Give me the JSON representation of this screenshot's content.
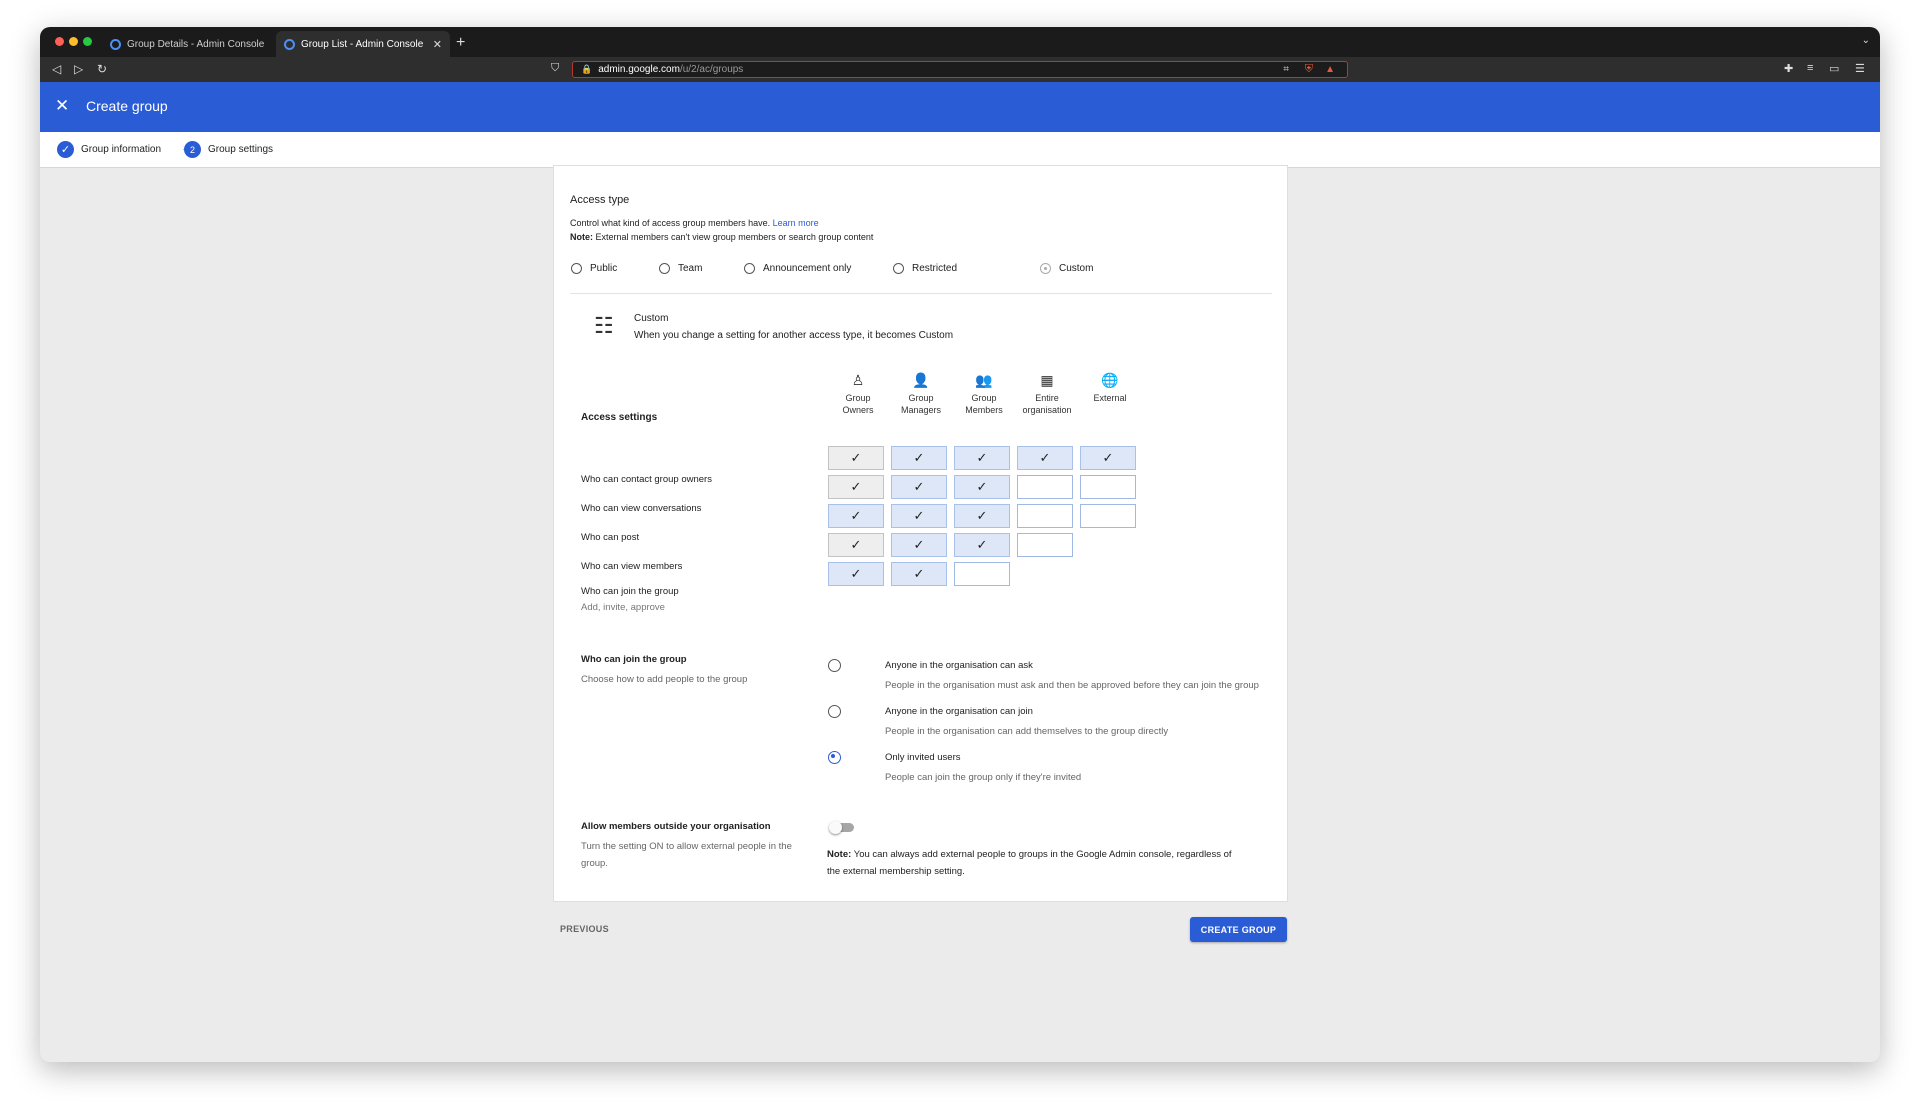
{
  "browser": {
    "tabs": [
      {
        "title": "Group Details - Admin Console",
        "active": false
      },
      {
        "title": "Group List - Admin Console",
        "active": true
      }
    ],
    "url_host": "admin.google.com",
    "url_path": "/u/2/ac/groups"
  },
  "appbar": {
    "title": "Create group"
  },
  "stepper": {
    "steps": [
      {
        "label": "Group information",
        "state": "done"
      },
      {
        "number": "2",
        "label": "Group settings",
        "state": "current"
      }
    ]
  },
  "access_type": {
    "heading": "Access type",
    "description": "Control what kind of access group members have.",
    "learn_more": "Learn more",
    "note_label": "Note:",
    "note_text": "External members can't view group members or search group content",
    "options": [
      "Public",
      "Team",
      "Announcement only",
      "Restricted",
      "Custom"
    ],
    "selected": "Custom"
  },
  "custom_info": {
    "title": "Custom",
    "description": "When you change a setting for another access type, it becomes Custom"
  },
  "access_settings": {
    "heading": "Access settings",
    "columns": [
      {
        "label_1": "Group",
        "label_2": "Owners",
        "icon": "person-outline-icon"
      },
      {
        "label_1": "Group",
        "label_2": "Managers",
        "icon": "person-icon"
      },
      {
        "label_1": "Group",
        "label_2": "Members",
        "icon": "people-icon"
      },
      {
        "label_1": "Entire",
        "label_2": "organisation",
        "icon": "building-icon"
      },
      {
        "label_1": "External",
        "label_2": "",
        "icon": "globe-icon"
      }
    ],
    "rows": [
      {
        "label": "Who can contact group owners",
        "sub": "",
        "cells": [
          "grey-check",
          "blue-check",
          "blue-check",
          "blue-check",
          "blue-check"
        ]
      },
      {
        "label": "Who can view conversations",
        "sub": "",
        "cells": [
          "grey-check",
          "blue-check",
          "blue-check",
          "empty",
          "empty"
        ]
      },
      {
        "label": "Who can post",
        "sub": "",
        "cells": [
          "blue-check",
          "blue-check",
          "blue-check",
          "empty",
          "empty"
        ]
      },
      {
        "label": "Who can view members",
        "sub": "",
        "cells": [
          "grey-check",
          "blue-check",
          "blue-check",
          "empty",
          "none"
        ]
      },
      {
        "label": "Who can join the group",
        "sub": "Add, invite, approve",
        "cells": [
          "blue-check",
          "blue-check",
          "empty",
          "none",
          "none"
        ]
      }
    ],
    "check_glyph": "✓"
  },
  "join": {
    "heading": "Who can join the group",
    "description": "Choose how to add people to the group",
    "options": [
      {
        "label": "Anyone in the organisation can ask",
        "desc": "People in the organisation must ask and then be approved before they can join the group"
      },
      {
        "label": "Anyone in the organisation can join",
        "desc": "People in the organisation can add themselves to the group directly"
      },
      {
        "label": "Only invited users",
        "desc": "People can join the group only if they're invited"
      }
    ],
    "selected": "Only invited users"
  },
  "external": {
    "heading": "Allow members outside your organisation",
    "description_1": "Turn the setting ON to allow external people in the",
    "description_2": "group.",
    "toggle_on": false,
    "note_label": "Note:",
    "note_text_1": "You can always add external people to groups in the Google Admin console, regardless of",
    "note_text_2": "the external membership setting."
  },
  "footer": {
    "previous": "PREVIOUS",
    "create": "CREATE GROUP"
  },
  "colors": {
    "brand_blue": "#2a5cd5",
    "cell_blue": "#dde7f7",
    "cell_grey": "#eeeeee"
  }
}
